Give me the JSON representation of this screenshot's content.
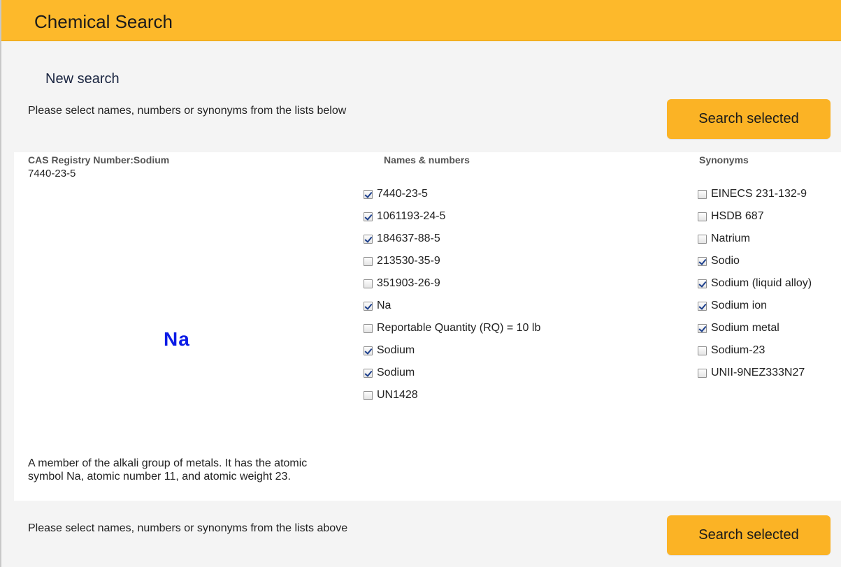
{
  "header": {
    "title": "Chemical Search"
  },
  "subtitle": "New search",
  "top_instruction": "Please select names, numbers or synonyms from the lists below",
  "bottom_instruction": "Please select names, numbers or synonyms from the lists above",
  "search_button_label": "Search selected",
  "compound": {
    "heading": "CAS Registry Number:Sodium",
    "cas_number": "7440-23-5",
    "symbol": "Na",
    "description": "A member of the alkali group of metals. It has the atomic symbol Na, atomic number 11, and atomic weight 23."
  },
  "names_numbers": {
    "heading": "Names & numbers",
    "items": [
      {
        "label": "7440-23-5",
        "checked": true
      },
      {
        "label": "1061193-24-5",
        "checked": true
      },
      {
        "label": "184637-88-5",
        "checked": true
      },
      {
        "label": "213530-35-9",
        "checked": false
      },
      {
        "label": "351903-26-9",
        "checked": false
      },
      {
        "label": "Na",
        "checked": true
      },
      {
        "label": "Reportable Quantity (RQ) = 10 lb",
        "checked": false
      },
      {
        "label": "Sodium",
        "checked": true
      },
      {
        "label": "Sodium",
        "checked": true
      },
      {
        "label": "UN1428",
        "checked": false
      }
    ]
  },
  "synonyms": {
    "heading": "Synonyms",
    "items": [
      {
        "label": "EINECS 231-132-9",
        "checked": false
      },
      {
        "label": "HSDB 687",
        "checked": false
      },
      {
        "label": "Natrium",
        "checked": false
      },
      {
        "label": "Sodio",
        "checked": true
      },
      {
        "label": "Sodium (liquid alloy)",
        "checked": true
      },
      {
        "label": "Sodium ion",
        "checked": true
      },
      {
        "label": "Sodium metal",
        "checked": true
      },
      {
        "label": "Sodium-23",
        "checked": false
      },
      {
        "label": "UNII-9NEZ333N27",
        "checked": false
      }
    ]
  },
  "colors": {
    "header": "#fdb92b",
    "button": "#fbb325",
    "symbol": "#0b1be6"
  }
}
